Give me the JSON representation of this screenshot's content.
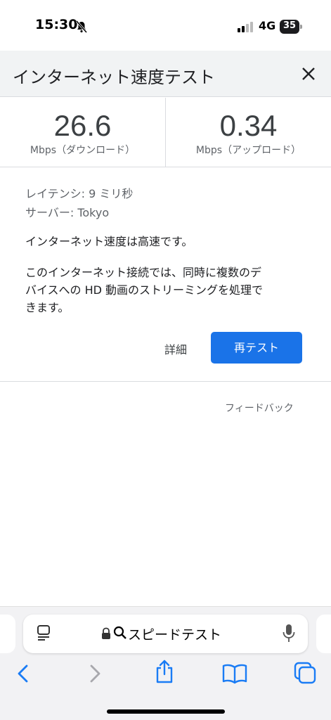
{
  "status_bar": {
    "time": "15:30",
    "network": "4G",
    "battery": "35"
  },
  "header": {
    "title": "インターネット速度テスト"
  },
  "speed": {
    "download_value": "26.6",
    "download_unit": "Mbps（ダウンロード）",
    "upload_value": "0.34",
    "upload_unit": "Mbps（アップロード）"
  },
  "info": {
    "latency": "レイテンシ: 9 ミリ秒",
    "server": "サーバー: Tokyo",
    "summary": "インターネット速度は高速です。",
    "description_line1": "このインターネット接続では、同時に複数のデ",
    "description_line2": "バイスへの HD 動画のストリーミングを処理で",
    "description_line3": "きます。"
  },
  "actions": {
    "details_label": "詳細",
    "retest_label": "再テスト",
    "feedback_label": "フィードバック"
  },
  "browser": {
    "address_text": "スピードテスト"
  },
  "colors": {
    "accent": "#1a73e8",
    "ios_blue": "#1a7cf5"
  }
}
